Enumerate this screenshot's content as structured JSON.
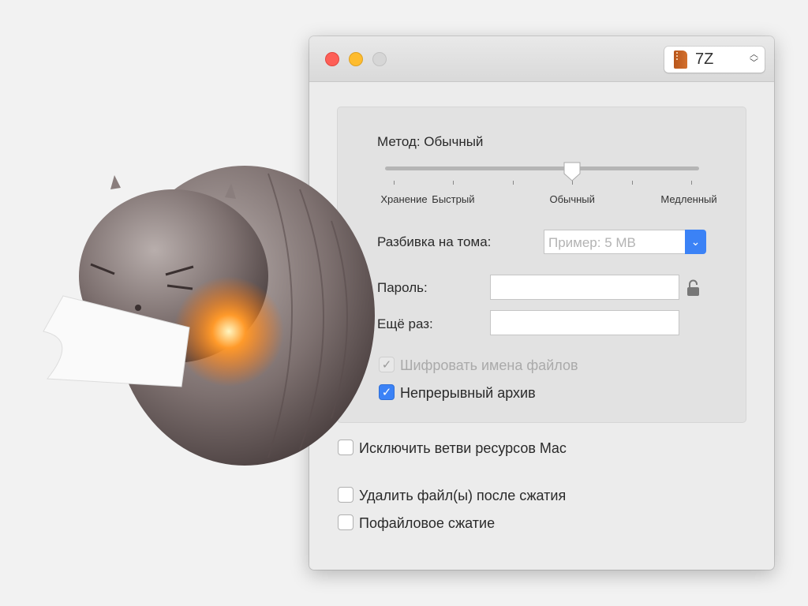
{
  "format_selector": {
    "value": "7Z",
    "icon": "archive-zip-icon"
  },
  "method": {
    "label": "Метод: Обычный",
    "slider_value": 3,
    "slider_max": 5,
    "tick_labels": [
      {
        "text": "Хранение",
        "tick": 0
      },
      {
        "text": "Быстрый",
        "tick": 1
      },
      {
        "text": "Обычный",
        "tick": 3
      },
      {
        "text": "Медленный",
        "tick": 5
      }
    ]
  },
  "split": {
    "label": "Разбивка на тома:",
    "placeholder": "Пример: 5 MB"
  },
  "password": {
    "label": "Пароль:",
    "value": ""
  },
  "repeat": {
    "label": "Ещё раз:",
    "value": ""
  },
  "encrypt_names": {
    "label": "Шифровать имена файлов",
    "checked": true,
    "disabled": true
  },
  "solid": {
    "label": "Непрерывный архив",
    "checked": true
  },
  "exclude_mac": {
    "label": "Исключить ветви ресурсов Mac",
    "checked": false
  },
  "delete_after": {
    "label": "Удалить файл(ы) после сжатия",
    "checked": false
  },
  "per_file": {
    "label": "Пофайловое сжатие",
    "checked": false
  },
  "colors": {
    "accent": "#3b82f6",
    "close": "#fe5f57",
    "minimize": "#febc2e"
  }
}
